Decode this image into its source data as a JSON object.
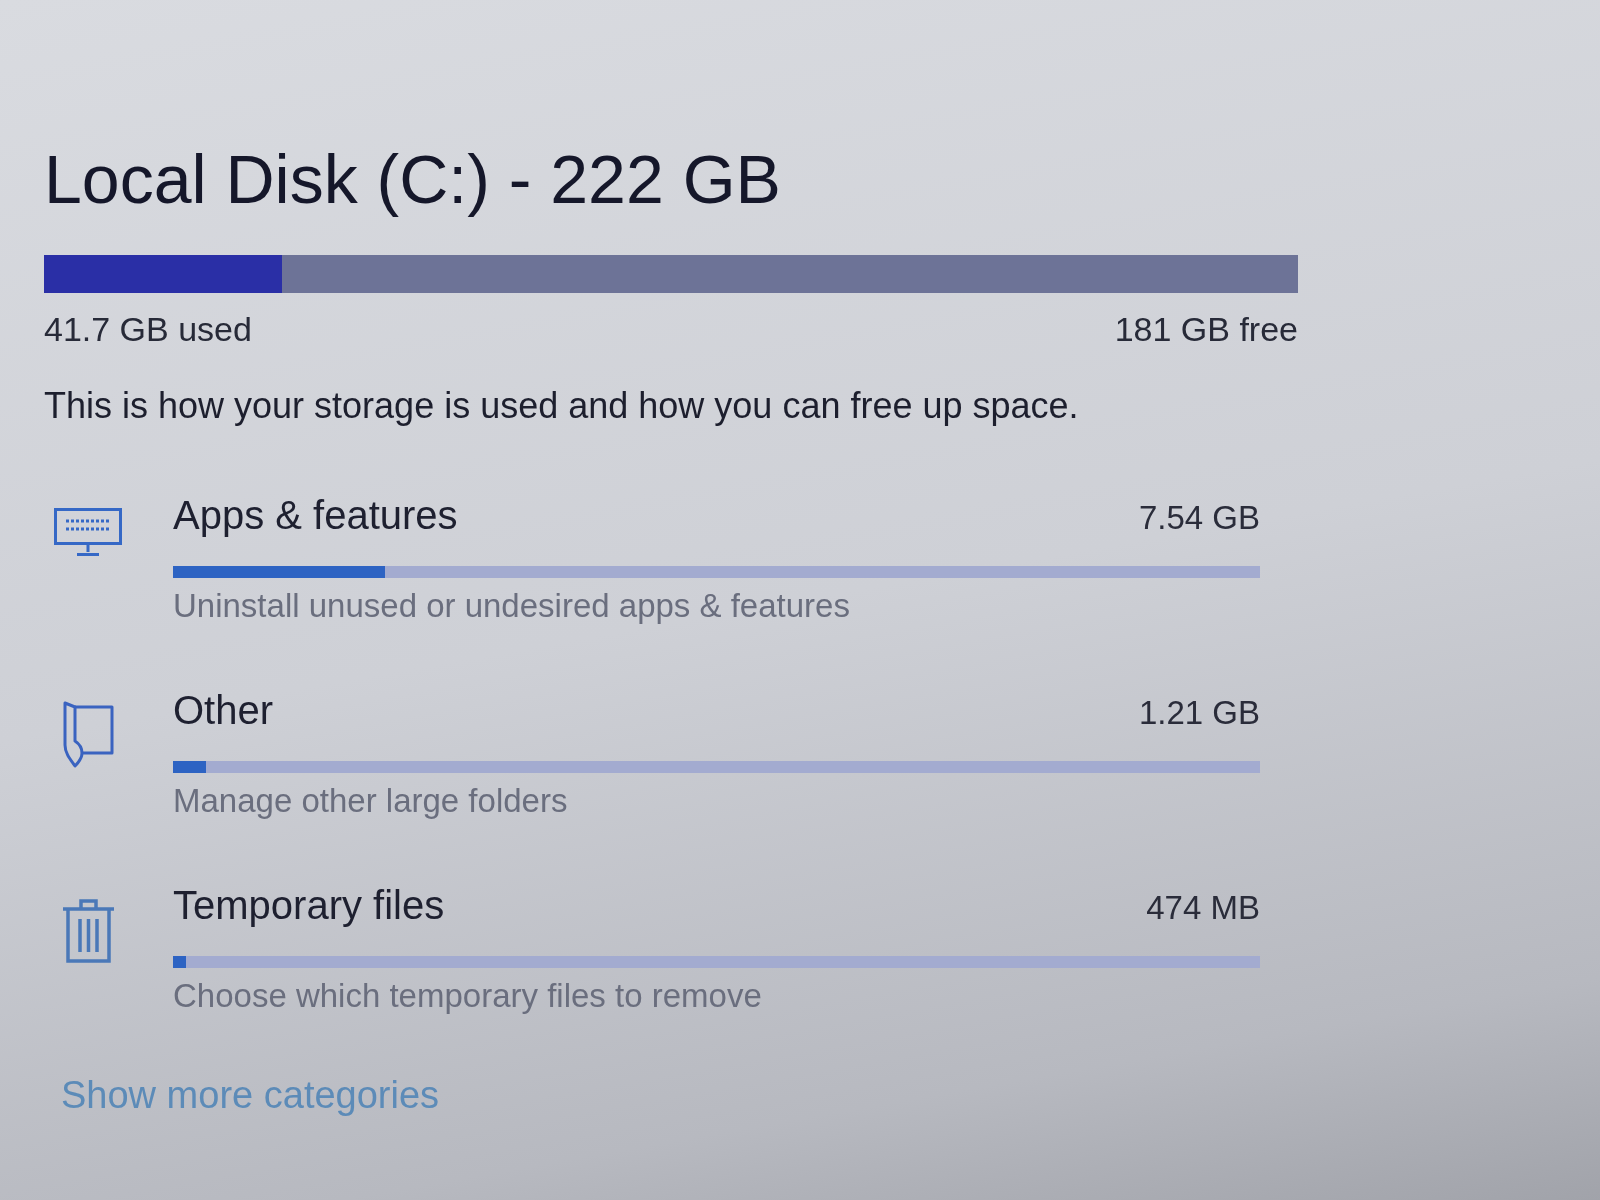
{
  "disk": {
    "title": "Local Disk (C:) - 222 GB",
    "level": 0.19,
    "used": "41.7 GB used",
    "free": "181 GB free"
  },
  "description": "This is how your storage is used and how you can free up space.",
  "categories": [
    {
      "kind": "apps",
      "name": "Apps & features",
      "size": "7.54 GB",
      "level": 0.195,
      "action": "Uninstall unused or undesired apps & features"
    },
    {
      "kind": "other",
      "name": "Other",
      "size": "1.21 GB",
      "level": 0.03,
      "action": "Manage other large folders"
    },
    {
      "kind": "temp",
      "name": "Temporary files",
      "size": "474 MB",
      "level": 0.012,
      "action": "Choose which temporary files to remove"
    }
  ],
  "show_more": "Show more categories"
}
